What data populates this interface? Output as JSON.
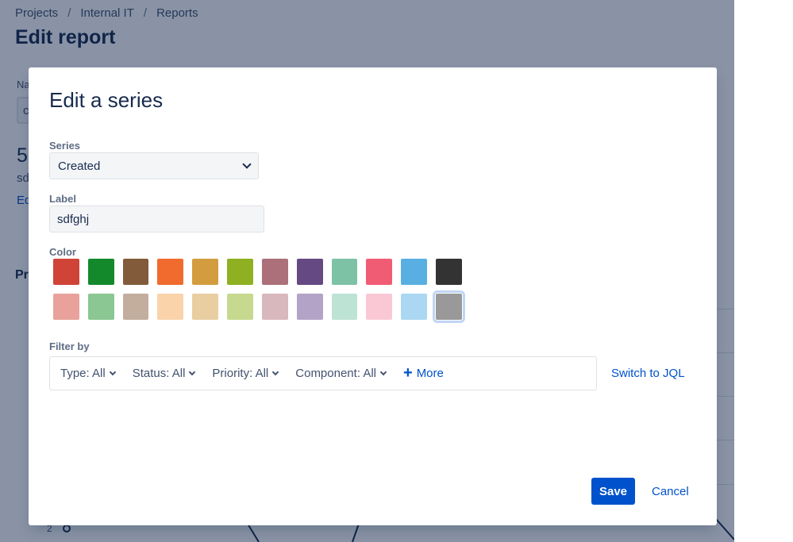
{
  "background": {
    "breadcrumb": {
      "projects": "Projects",
      "internal_it": "Internal IT",
      "reports": "Reports",
      "separator": "/"
    },
    "page_title": "Edit report",
    "fragments": {
      "name_label": "Na",
      "input_char": "c",
      "big_num": "5",
      "sd_text": "sd",
      "edit_link": "Ed",
      "pr_heading": "Pr",
      "axis_tick": "2"
    }
  },
  "modal": {
    "title": "Edit a series",
    "series": {
      "label": "Series",
      "value": "Created"
    },
    "label_field": {
      "label": "Label",
      "value": "sdfghj"
    },
    "color": {
      "label": "Color",
      "row1": [
        "#d04437",
        "#14892c",
        "#815b3a",
        "#f06b2d",
        "#d39c3f",
        "#8eb021",
        "#ac707a",
        "#654982",
        "#7ec2a5",
        "#f15c75",
        "#59afe1",
        "#333333"
      ],
      "row2": [
        "#e8a29b",
        "#8ac793",
        "#c3ae9e",
        "#fad3ab",
        "#e9cea1",
        "#c6d98f",
        "#d8b7bd",
        "#b3a3c6",
        "#bde3d4",
        "#fac8d5",
        "#abd7f2",
        "#999999"
      ],
      "selected": "#999999"
    },
    "filter": {
      "label": "Filter by",
      "items": [
        "Type: All",
        "Status: All",
        "Priority: All",
        "Component: All"
      ],
      "more": "More",
      "switch_jql": "Switch to JQL"
    },
    "save": "Save",
    "cancel": "Cancel"
  }
}
